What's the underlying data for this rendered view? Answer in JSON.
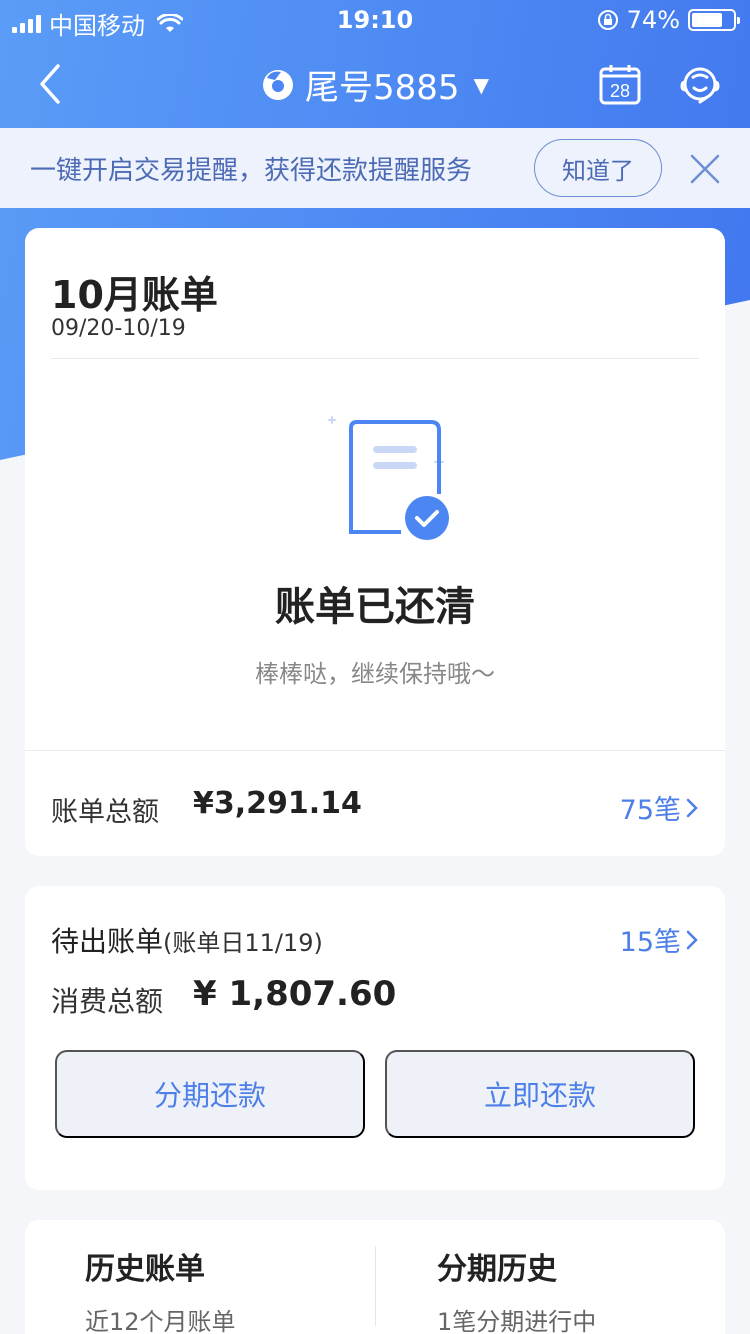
{
  "status_bar": {
    "carrier": "中国移动",
    "time": "19:10",
    "battery_percent_text": "74%",
    "battery_level": 0.74
  },
  "nav": {
    "title": "尾号5885",
    "calendar_day": "28",
    "icons": [
      "back-icon",
      "bank-logo-icon",
      "caret-down-icon",
      "calendar-icon",
      "customer-service-icon"
    ]
  },
  "notice": {
    "text": "一键开启交易提醒，获得还款提醒服务",
    "button_label": "知道了"
  },
  "bill": {
    "title": "10月账单",
    "period": "09/20-10/19",
    "status_title": "账单已还清",
    "status_subtitle": "棒棒哒，继续保持哦～",
    "total_label": "账单总额",
    "total_amount": "¥3,291.14",
    "count": "75笔"
  },
  "pending": {
    "title": "待出账单",
    "bill_date": "(账单日11/19)",
    "count": "15笔",
    "spend_label": "消费总额",
    "spend_amount": "¥ 1,807.60",
    "installment_button": "分期还款",
    "repay_button": "立即还款"
  },
  "history": {
    "left_title": "历史账单",
    "left_sub": "近12个月账单",
    "right_title": "分期历史",
    "right_sub": "1笔分期进行中"
  },
  "colors": {
    "brand_blue": "#4b86f2",
    "link_blue": "#4d7fe8",
    "notice_bg": "#edf2fc"
  }
}
